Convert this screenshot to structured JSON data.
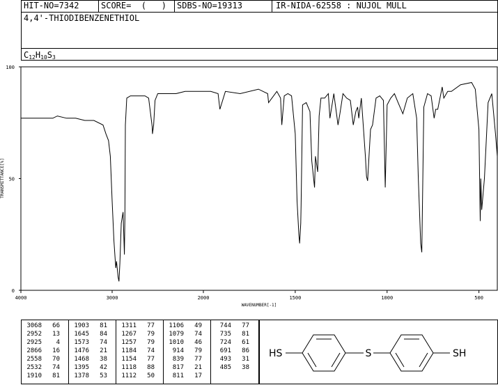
{
  "header": {
    "hit_no": "HIT-NO=7342",
    "score": "SCORE=  (   )",
    "sdbs_no": "SDBS-NO=19313",
    "ir_nida": "IR-NIDA-62558 : NUJOL MULL"
  },
  "compound": {
    "name": "4,4'-THIODIBENZENETHIOL",
    "formula_c": "C",
    "formula_c_n": "12",
    "formula_h": "H",
    "formula_h_n": "10",
    "formula_s": "S",
    "formula_s_n": "3"
  },
  "structure": {
    "left_group": "HS",
    "bridge": "S",
    "right_group": "SH"
  },
  "chart_data": {
    "type": "line",
    "xlabel": "WAVENUMBER[-1]",
    "ylabel": "TRANSMITTANCE[%]",
    "xlim": [
      4000,
      400
    ],
    "ylim": [
      0,
      100
    ],
    "x_ticks": [
      "4000",
      "3000",
      "2000",
      "1500",
      "1000",
      "500"
    ],
    "y_ticks": [
      "100",
      "50",
      "0"
    ],
    "x": [
      4000,
      3900,
      3800,
      3700,
      3650,
      3600,
      3500,
      3400,
      3300,
      3200,
      3100,
      3068,
      3040,
      3020,
      3000,
      2980,
      2960,
      2952,
      2940,
      2935,
      2925,
      2915,
      2900,
      2880,
      2866,
      2860,
      2855,
      2840,
      2800,
      2700,
      2640,
      2600,
      2560,
      2558,
      2545,
      2530,
      2500,
      2400,
      2300,
      2200,
      2100,
      2000,
      1960,
      1920,
      1910,
      1880,
      1800,
      1700,
      1650,
      1645,
      1600,
      1580,
      1573,
      1560,
      1540,
      1520,
      1500,
      1490,
      1480,
      1476,
      1470,
      1468,
      1460,
      1440,
      1420,
      1410,
      1395,
      1390,
      1378,
      1370,
      1360,
      1340,
      1320,
      1311,
      1290,
      1267,
      1257,
      1240,
      1220,
      1200,
      1184,
      1170,
      1160,
      1154,
      1140,
      1130,
      1118,
      1112,
      1106,
      1090,
      1079,
      1060,
      1040,
      1020,
      1010,
      1000,
      980,
      960,
      940,
      914,
      890,
      860,
      839,
      830,
      817,
      811,
      800,
      780,
      760,
      744,
      735,
      724,
      700,
      691,
      670,
      650,
      600,
      540,
      520,
      500,
      493,
      490,
      485,
      470,
      450,
      430,
      410,
      400
    ],
    "series": [
      {
        "values": [
          77,
          77,
          77,
          77,
          77,
          78,
          77,
          77,
          76,
          76,
          74,
          70,
          67,
          60,
          40,
          22,
          10,
          13,
          8,
          6,
          4,
          12,
          30,
          35,
          16,
          32,
          74,
          86,
          87,
          87,
          87,
          86,
          73,
          70,
          74,
          85,
          88,
          88,
          88,
          89,
          89,
          89,
          89,
          88,
          81,
          89,
          88,
          90,
          88,
          84,
          89,
          86,
          74,
          87,
          88,
          87,
          70,
          40,
          25,
          21,
          30,
          38,
          83,
          84,
          80,
          58,
          46,
          60,
          53,
          78,
          86,
          86,
          88,
          77,
          88,
          74,
          79,
          88,
          86,
          85,
          74,
          80,
          82,
          77,
          86,
          74,
          60,
          51,
          49,
          72,
          74,
          86,
          87,
          85,
          46,
          83,
          86,
          88,
          84,
          79,
          86,
          88,
          77,
          50,
          21,
          17,
          82,
          88,
          87,
          77,
          81,
          81,
          91,
          86,
          89,
          89,
          92,
          93,
          90,
          72,
          31,
          50,
          36,
          50,
          84,
          88,
          70,
          60
        ]
      }
    ],
    "peak_table": {
      "columns": [
        [
          [
            3068,
            66
          ],
          [
            2952,
            13
          ],
          [
            2925,
            4
          ],
          [
            2866,
            16
          ],
          [
            2558,
            70
          ],
          [
            2532,
            74
          ],
          [
            1910,
            81
          ]
        ],
        [
          [
            1903,
            81
          ],
          [
            1645,
            84
          ],
          [
            1573,
            74
          ],
          [
            1476,
            21
          ],
          [
            1468,
            38
          ],
          [
            1395,
            42
          ],
          [
            1378,
            53
          ]
        ],
        [
          [
            1311,
            77
          ],
          [
            1267,
            79
          ],
          [
            1257,
            79
          ],
          [
            1184,
            74
          ],
          [
            1154,
            77
          ],
          [
            1118,
            88
          ],
          [
            1112,
            50
          ]
        ],
        [
          [
            1106,
            49
          ],
          [
            1079,
            74
          ],
          [
            1010,
            46
          ],
          [
            914,
            79
          ],
          [
            839,
            77
          ],
          [
            817,
            21
          ],
          [
            811,
            17
          ]
        ],
        [
          [
            744,
            77
          ],
          [
            735,
            81
          ],
          [
            724,
            61
          ],
          [
            691,
            86
          ],
          [
            493,
            31
          ],
          [
            485,
            38
          ]
        ]
      ]
    }
  }
}
